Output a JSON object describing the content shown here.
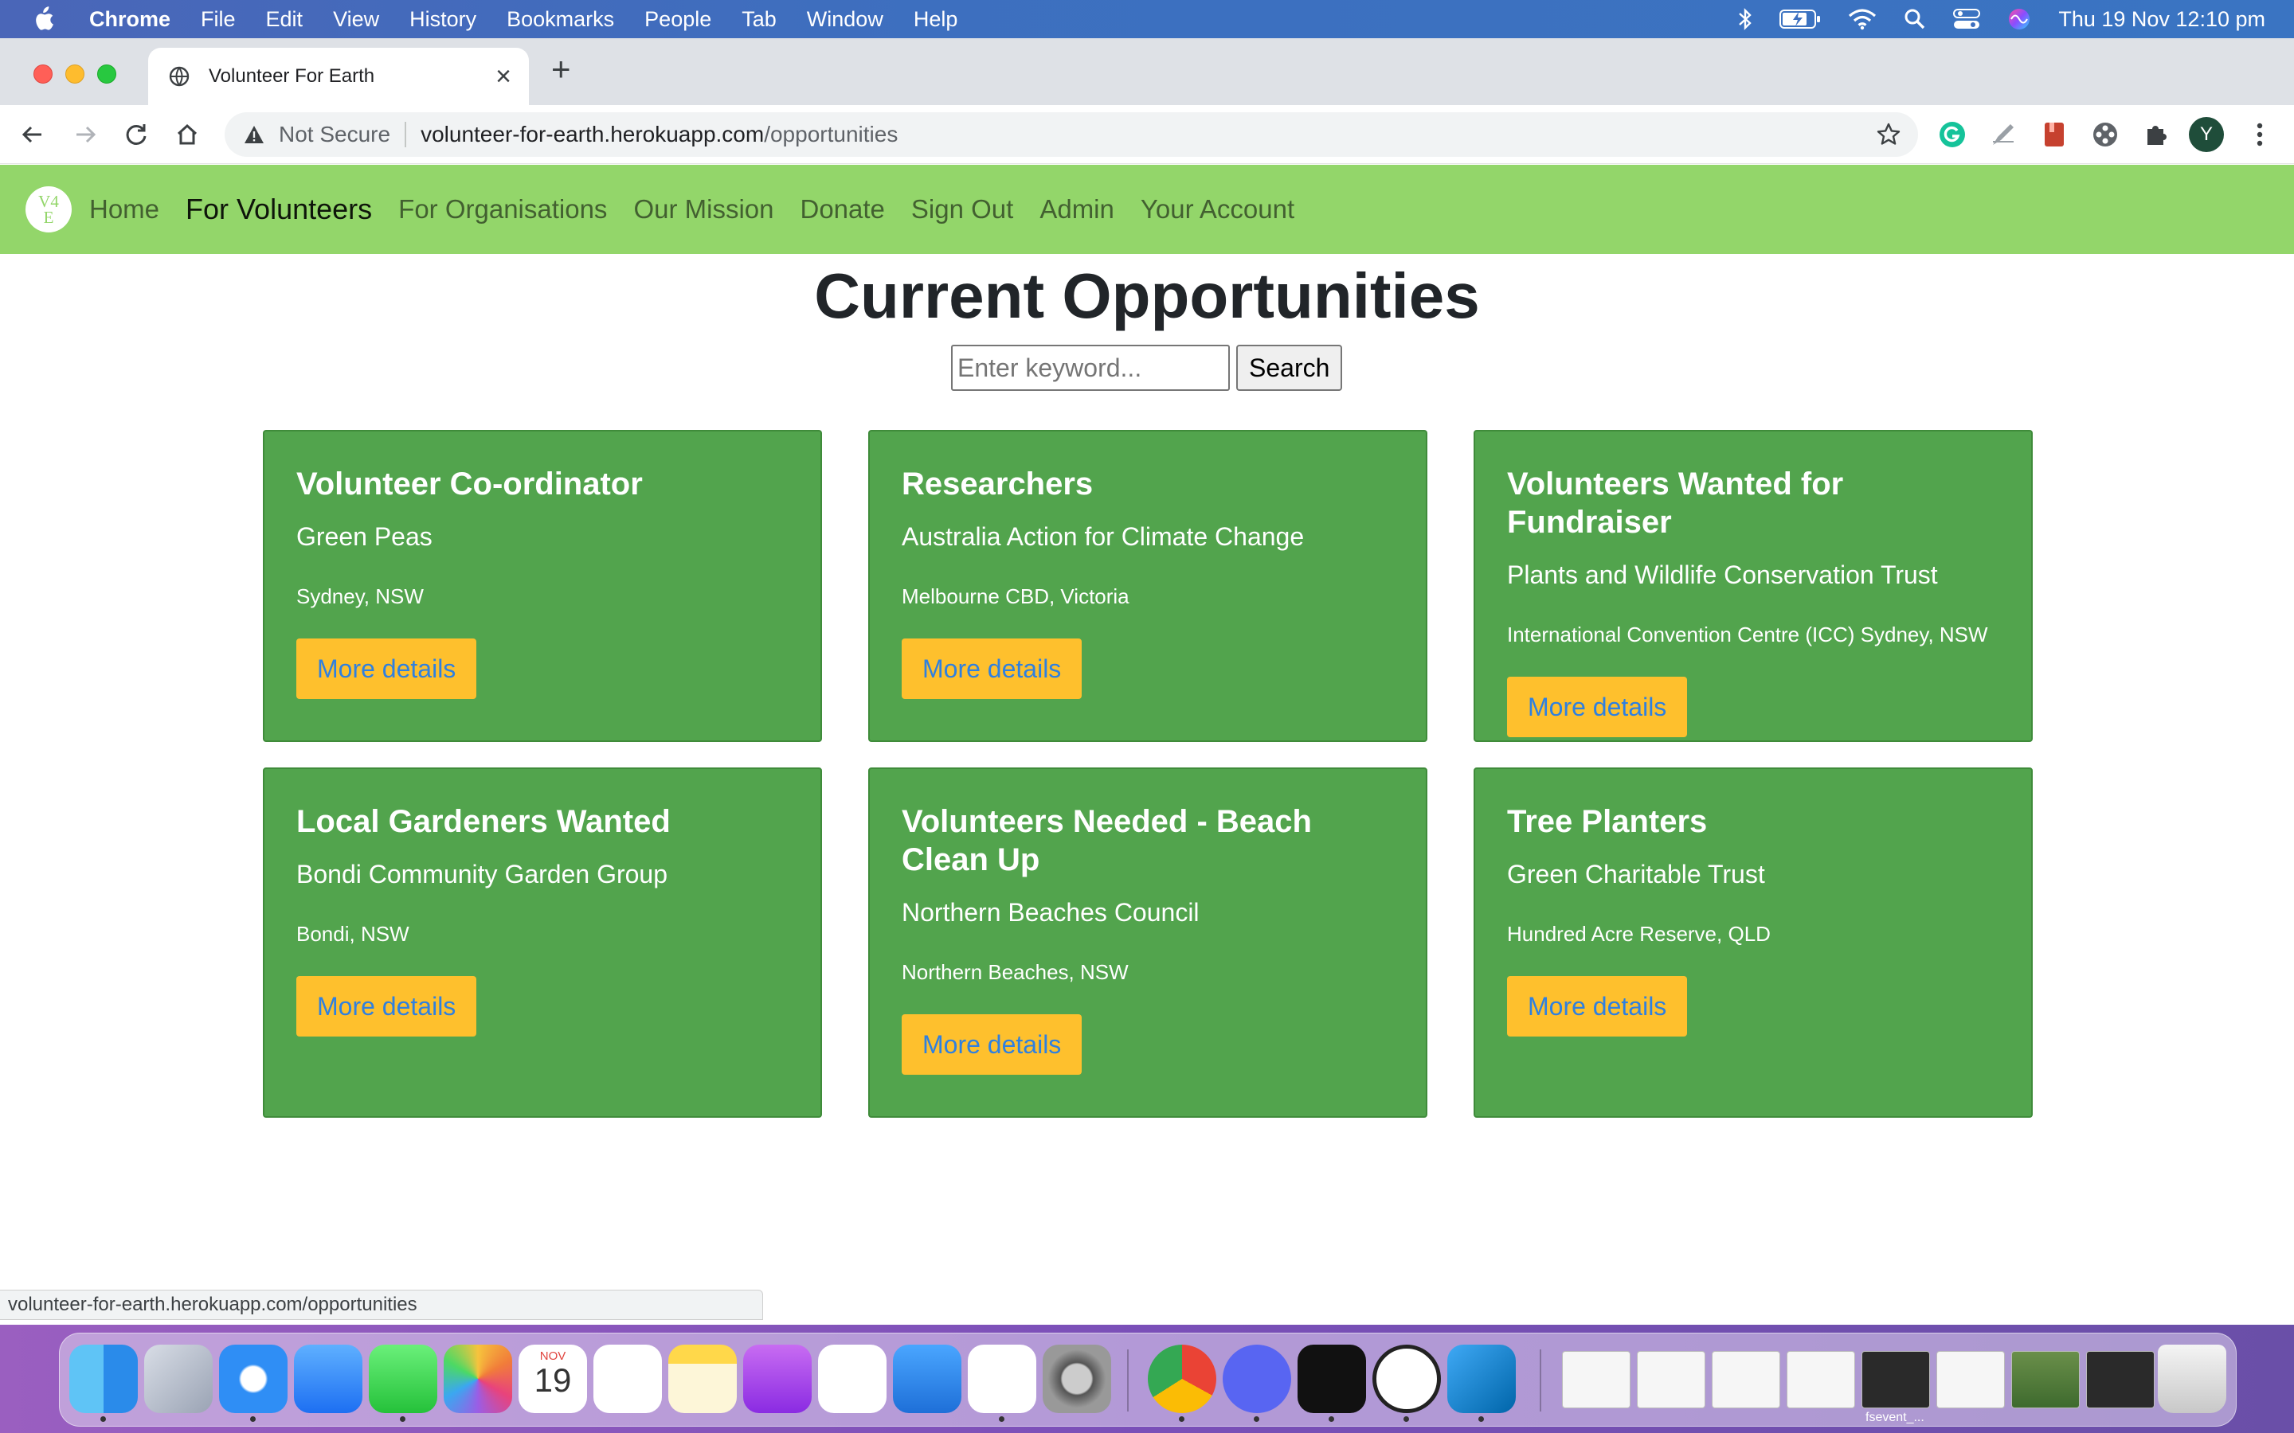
{
  "menubar": {
    "app": "Chrome",
    "items": [
      "File",
      "Edit",
      "View",
      "History",
      "Bookmarks",
      "People",
      "Tab",
      "Window",
      "Help"
    ],
    "clock": "Thu 19 Nov  12:10 pm"
  },
  "browser": {
    "tab_title": "Volunteer For Earth",
    "security_label": "Not Secure",
    "url_host": "volunteer-for-earth.herokuapp.com",
    "url_path": "/opportunities",
    "profile_initial": "Y",
    "status_url": "volunteer-for-earth.herokuapp.com/opportunities"
  },
  "site": {
    "logo": [
      "V4",
      "E"
    ],
    "nav": [
      "Home",
      "For Volunteers",
      "For Organisations",
      "Our Mission",
      "Donate",
      "Sign Out",
      "Admin",
      "Your Account"
    ],
    "active_nav": "For Volunteers",
    "heading": "Current Opportunities",
    "search": {
      "placeholder": "Enter keyword...",
      "button": "Search"
    },
    "more_label": "More details",
    "opportunities": [
      {
        "title": "Volunteer Co-ordinator",
        "org": "Green Peas",
        "location": "Sydney, NSW"
      },
      {
        "title": "Researchers",
        "org": "Australia Action for Climate Change",
        "location": "Melbourne CBD, Victoria"
      },
      {
        "title": "Volunteers Wanted for Fundraiser",
        "org": "Plants and Wildlife Conservation Trust",
        "location": "International Convention Centre (ICC) Sydney, NSW"
      },
      {
        "title": "Local Gardeners Wanted",
        "org": "Bondi Community Garden Group",
        "location": "Bondi, NSW"
      },
      {
        "title": "Volunteers Needed - Beach Clean Up",
        "org": "Northern Beaches Council",
        "location": "Northern Beaches, NSW"
      },
      {
        "title": "Tree Planters",
        "org": "Green Charitable Trust",
        "location": "Hundred Acre Reserve, QLD"
      }
    ]
  },
  "dock": {
    "calendar_month": "NOV",
    "calendar_day": "19",
    "thumb_label": "fsevent_..."
  },
  "colors": {
    "nav_bg": "#93d66a",
    "card_bg": "#52a44d",
    "button_bg": "#fec02d",
    "button_text": "#2f80e0"
  }
}
